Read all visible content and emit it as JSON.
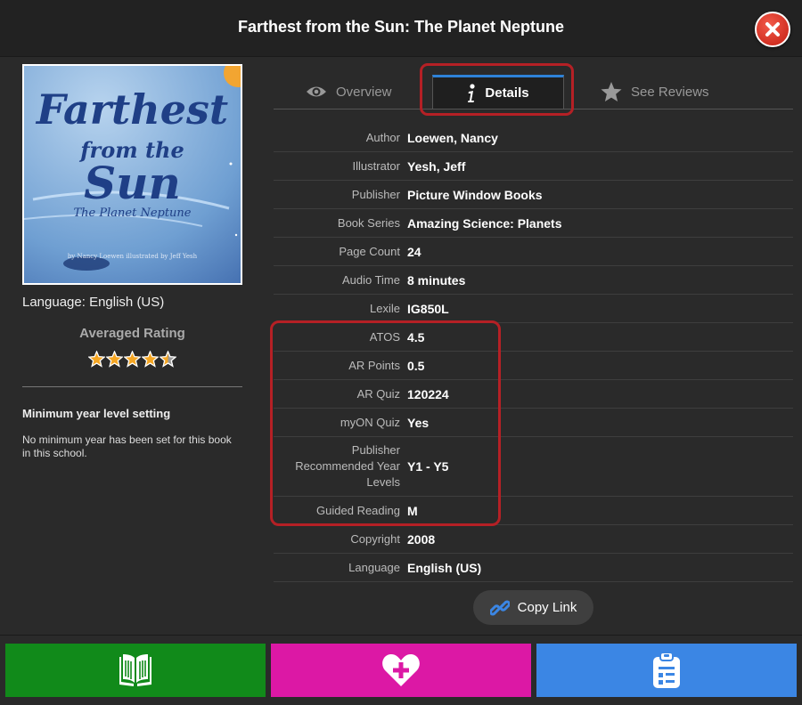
{
  "header": {
    "title": "Farthest from the Sun: The Planet Neptune",
    "close_icon": "close-icon"
  },
  "cover": {
    "title_line1": "Farthest",
    "title_line2": "from the",
    "title_line3": "Sun",
    "subtitle": "The Planet Neptune",
    "byline": "by Nancy Loewen   illustrated by Jeff Yesh"
  },
  "sidebar": {
    "language": "Language: English (US)",
    "averaged_rating_label": "Averaged Rating",
    "rating_stars": 4.5,
    "rating_max": 5,
    "min_year_title": "Minimum year level setting",
    "min_year_text": "No minimum year has been set for this book in this school."
  },
  "tabs": [
    {
      "label": "Overview",
      "icon": "eye-icon"
    },
    {
      "label": "Details",
      "icon": "info-icon",
      "selected": true
    },
    {
      "label": "See Reviews",
      "icon": "star-icon"
    }
  ],
  "details": [
    {
      "label": "Author",
      "value": "Loewen, Nancy"
    },
    {
      "label": "Illustrator",
      "value": "Yesh, Jeff"
    },
    {
      "label": "Publisher",
      "value": "Picture Window Books"
    },
    {
      "label": "Book Series",
      "value": "Amazing Science: Planets"
    },
    {
      "label": "Page Count",
      "value": "24"
    },
    {
      "label": "Audio Time",
      "value": "8 minutes"
    },
    {
      "label": "Lexile",
      "value": "IG850L"
    },
    {
      "label": "ATOS",
      "value": "4.5"
    },
    {
      "label": "AR Points",
      "value": "0.5"
    },
    {
      "label": "AR Quiz",
      "value": "120224"
    },
    {
      "label": "myON Quiz",
      "value": "Yes"
    },
    {
      "label": "Publisher Recommended Year Levels",
      "value": "Y1 - Y5"
    },
    {
      "label": "Guided Reading",
      "value": "M"
    },
    {
      "label": "Copyright",
      "value": "2008"
    },
    {
      "label": "Language",
      "value": "English (US)"
    }
  ],
  "copy_link": {
    "label": "Copy Link",
    "icon": "link-icon"
  },
  "footer_buttons": [
    {
      "action": "read",
      "icon": "open-book-icon",
      "color": "#118a1a"
    },
    {
      "action": "favorite",
      "icon": "heart-plus-icon",
      "color": "#dc18a5"
    },
    {
      "action": "assign",
      "icon": "clipboard-icon",
      "color": "#3b86e4"
    }
  ],
  "colors": {
    "highlight": "#b52025",
    "tab_accent": "#2e82d8",
    "star": "#f5a623"
  }
}
